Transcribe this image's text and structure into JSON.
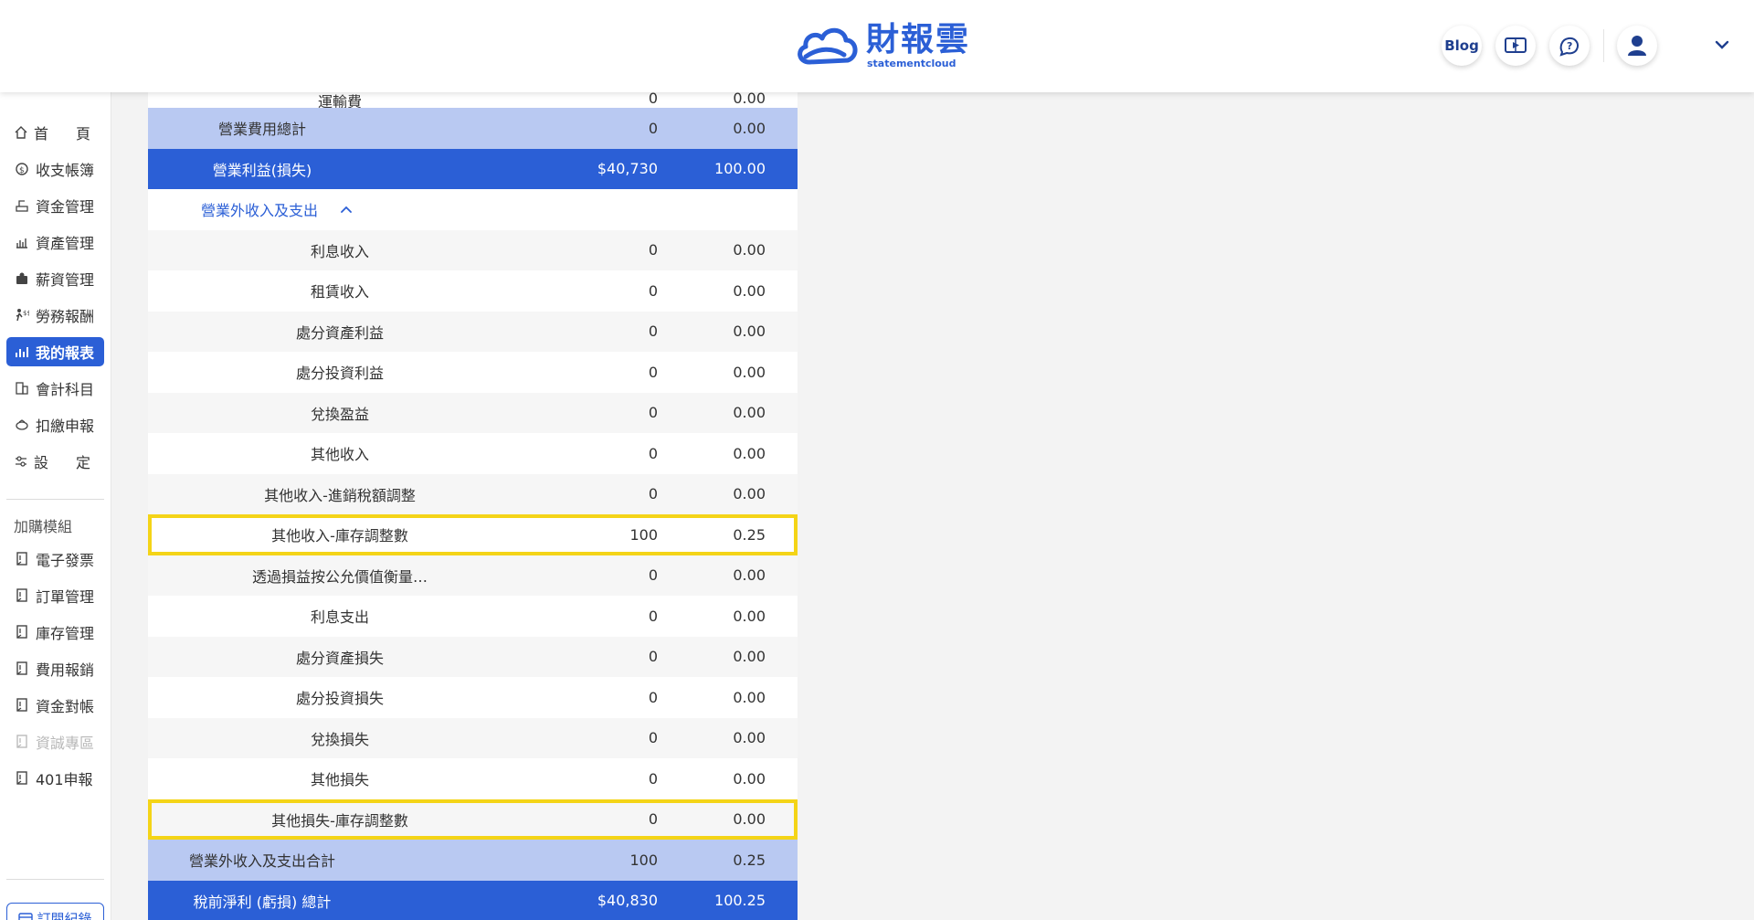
{
  "app": {
    "brand_main": "財報雲",
    "brand_sub": "statementcloud"
  },
  "header": {
    "blog_label": "Blog"
  },
  "sidebar": {
    "items": [
      {
        "label": "首頁",
        "icon": "home-icon"
      },
      {
        "label": "收支帳簿",
        "icon": "coin-clock-icon"
      },
      {
        "label": "資金管理",
        "icon": "cash-icon"
      },
      {
        "label": "資產管理",
        "icon": "asset-icon"
      },
      {
        "label": "薪資管理",
        "icon": "payroll-icon"
      },
      {
        "label": "勞務報酬",
        "icon": "labor-icon"
      },
      {
        "label": "我的報表",
        "icon": "chart-icon",
        "active": true
      },
      {
        "label": "會計科目",
        "icon": "ledger-icon"
      },
      {
        "label": "扣繳申報",
        "icon": "tax-icon"
      },
      {
        "label": "設定",
        "icon": "settings-icon"
      }
    ],
    "section_title": "加購模組",
    "modules": [
      {
        "label": "電子發票",
        "disabled": false
      },
      {
        "label": "訂單管理",
        "disabled": false
      },
      {
        "label": "庫存管理",
        "disabled": false
      },
      {
        "label": "費用報銷",
        "disabled": false
      },
      {
        "label": "資金對帳",
        "disabled": false
      },
      {
        "label": "資誠專區",
        "disabled": true
      },
      {
        "label": "401申報",
        "disabled": false
      }
    ],
    "subscribe_label": "訂閱紀錄"
  },
  "report": {
    "partial_top": {
      "label": "運輸費",
      "amount": "0",
      "percent": "0.00"
    },
    "rows": [
      {
        "label": "營業費用總計",
        "amount": "0",
        "percent": "0.00",
        "style": "subtotal"
      },
      {
        "label": "營業利益(損失)",
        "amount": "$40,730",
        "percent": "100.00",
        "style": "total"
      },
      {
        "label": "營業外收入及支出",
        "amount": "",
        "percent": "",
        "style": "section"
      },
      {
        "label": "利息收入",
        "amount": "0",
        "percent": "0.00",
        "style": "alt"
      },
      {
        "label": "租賃收入",
        "amount": "0",
        "percent": "0.00",
        "style": "white"
      },
      {
        "label": "處分資產利益",
        "amount": "0",
        "percent": "0.00",
        "style": "alt"
      },
      {
        "label": "處分投資利益",
        "amount": "0",
        "percent": "0.00",
        "style": "white"
      },
      {
        "label": "兌換盈益",
        "amount": "0",
        "percent": "0.00",
        "style": "alt"
      },
      {
        "label": "其他收入",
        "amount": "0",
        "percent": "0.00",
        "style": "white"
      },
      {
        "label": "其他收入-進銷稅額調整",
        "amount": "0",
        "percent": "0.00",
        "style": "alt"
      },
      {
        "label": "其他收入-庫存調整數",
        "amount": "100",
        "percent": "0.25",
        "style": "white",
        "highlight": true
      },
      {
        "label": "透過損益按公允價值衡量…",
        "amount": "0",
        "percent": "0.00",
        "style": "alt"
      },
      {
        "label": "利息支出",
        "amount": "0",
        "percent": "0.00",
        "style": "white"
      },
      {
        "label": "處分資產損失",
        "amount": "0",
        "percent": "0.00",
        "style": "alt"
      },
      {
        "label": "處分投資損失",
        "amount": "0",
        "percent": "0.00",
        "style": "white"
      },
      {
        "label": "兌換損失",
        "amount": "0",
        "percent": "0.00",
        "style": "alt"
      },
      {
        "label": "其他損失",
        "amount": "0",
        "percent": "0.00",
        "style": "white"
      },
      {
        "label": "其他損失-庫存調整數",
        "amount": "0",
        "percent": "0.00",
        "style": "alt",
        "highlight": true
      },
      {
        "label": "營業外收入及支出合計",
        "amount": "100",
        "percent": "0.25",
        "style": "subtotal"
      },
      {
        "label": "稅前淨利 (虧損) 總計",
        "amount": "$40,830",
        "percent": "100.25",
        "style": "total"
      }
    ]
  },
  "colors": {
    "brand": "#2b5fd6",
    "subtotal": "#b9c9f2",
    "highlight": "#f4d417"
  }
}
